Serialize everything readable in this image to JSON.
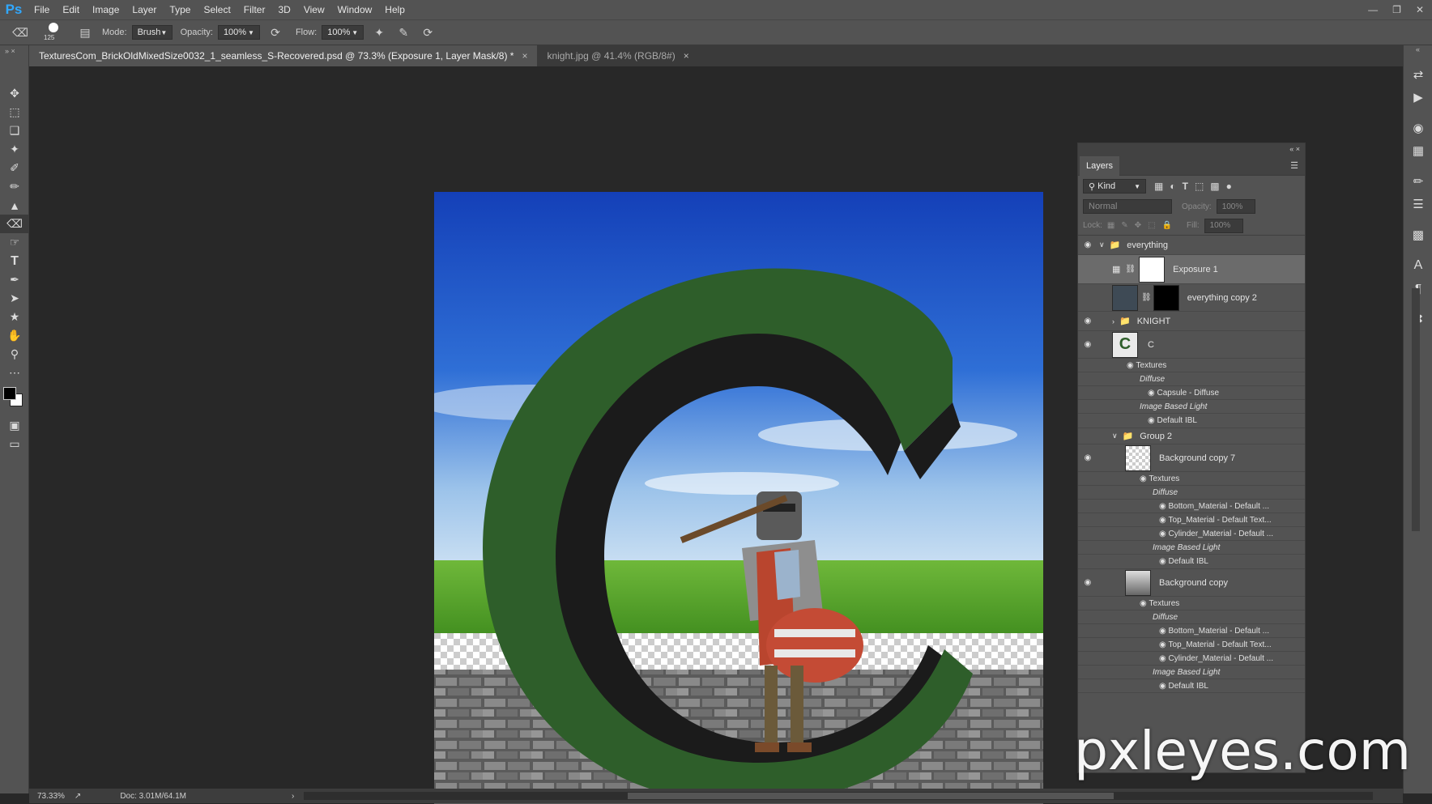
{
  "app": {
    "logo": "Ps"
  },
  "menu": [
    "File",
    "Edit",
    "Image",
    "Layer",
    "Type",
    "Select",
    "Filter",
    "3D",
    "View",
    "Window",
    "Help"
  ],
  "options": {
    "brush_size": "125",
    "mode_label": "Mode:",
    "mode_value": "Brush",
    "opacity_label": "Opacity:",
    "opacity_value": "100%",
    "flow_label": "Flow:",
    "flow_value": "100%"
  },
  "tabs": [
    {
      "label": "TexturesCom_BrickOldMixedSize0032_1_seamless_S-Recovered.psd @ 73.3% (Exposure 1, Layer Mask/8) *",
      "active": true
    },
    {
      "label": "knight.jpg @ 41.4% (RGB/8#)",
      "active": false
    }
  ],
  "layers_panel": {
    "title": "Layers",
    "filter_kind": "Kind",
    "blend_mode": "Normal",
    "opacity_label": "Opacity:",
    "opacity_value": "100%",
    "lock_label": "Lock:",
    "fill_label": "Fill:",
    "fill_value": "100%",
    "rows": {
      "everything": "everything",
      "exposure": "Exposure 1",
      "everything_copy2": "everything copy 2",
      "knight": "KNIGHT",
      "c": "C",
      "c_textures": "Textures",
      "c_diffuse": "Diffuse",
      "c_capsule": "Capsule - Diffuse",
      "c_ibl": "Image Based Light",
      "c_default_ibl": "Default IBL",
      "group2": "Group 2",
      "bg7": "Background copy 7",
      "bg7_textures": "Textures",
      "bg7_diffuse": "Diffuse",
      "bg7_bottom": "Bottom_Material - Default ...",
      "bg7_top": "Top_Material - Default Text...",
      "bg7_cyl": "Cylinder_Material - Default ...",
      "bg7_ibl": "Image Based Light",
      "bg7_default_ibl": "Default IBL",
      "bg": "Background copy",
      "bg_textures": "Textures",
      "bg_diffuse": "Diffuse",
      "bg_bottom": "Bottom_Material - Default ...",
      "bg_top": "Top_Material - Default Text...",
      "bg_cyl": "Cylinder_Material - Default ...",
      "bg_ibl": "Image Based Light",
      "bg_default_ibl": "Default IBL"
    }
  },
  "status": {
    "zoom": "73.33%",
    "doc": "Doc: 3.01M/64.1M"
  },
  "watermark": "pxleyes.com",
  "colors": {
    "accent": "#31a8ff",
    "letter_green": "#2e5e2a",
    "sky": "#1f57c9"
  }
}
